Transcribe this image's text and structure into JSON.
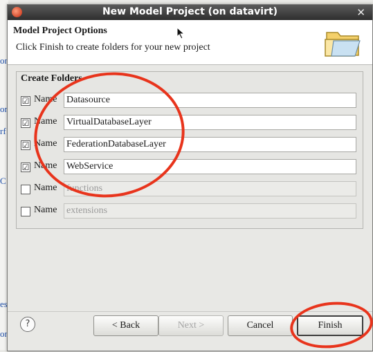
{
  "window": {
    "title": "New Model Project  (on datavirt)"
  },
  "header": {
    "title": "Model Project Options",
    "description": "Click Finish to create folders for your new project"
  },
  "group": {
    "title": "Create Folders",
    "rows": [
      {
        "label": "Name",
        "value": "Datasource",
        "checked": true,
        "check_glyph": "☑"
      },
      {
        "label": "Name",
        "value": "VirtualDatabaseLayer",
        "checked": true,
        "check_glyph": "☑"
      },
      {
        "label": "Name",
        "value": "FederationDatabaseLayer",
        "checked": true,
        "check_glyph": "☑"
      },
      {
        "label": "Name",
        "value": "WebService",
        "checked": true,
        "check_glyph": "☑"
      },
      {
        "label": "Name",
        "value": "functions",
        "checked": false,
        "check_glyph": ""
      },
      {
        "label": "Name",
        "value": "extensions",
        "checked": false,
        "check_glyph": ""
      }
    ]
  },
  "buttons": {
    "help": "?",
    "back": "< Back",
    "next": "Next >",
    "cancel": "Cancel",
    "finish": "Finish"
  },
  "background_fragments": [
    "on",
    "on",
    "rf",
    "C",
    "es",
    "on"
  ],
  "colors": {
    "annotation": "#e8341c",
    "link": "#1f4fa8"
  }
}
